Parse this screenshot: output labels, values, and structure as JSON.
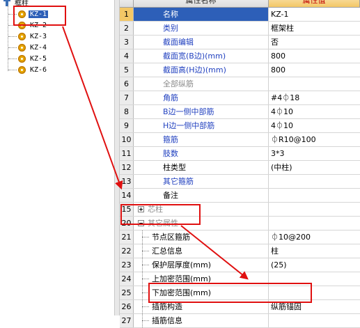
{
  "tree": {
    "root_label": "框柱",
    "items": [
      {
        "label": "KZ-1",
        "selected": true
      },
      {
        "label": "KZ-2"
      },
      {
        "label": "KZ-3"
      },
      {
        "label": "KZ-4"
      },
      {
        "label": "KZ-5"
      },
      {
        "label": "KZ-6"
      }
    ]
  },
  "grid": {
    "header_name": "属性名称",
    "header_value": "属性值",
    "rows": [
      {
        "num": "1",
        "name": "名称",
        "value": "KZ-1"
      },
      {
        "num": "2",
        "name": "类别",
        "value": "框架柱"
      },
      {
        "num": "3",
        "name": "截面编辑",
        "value": "否"
      },
      {
        "num": "4",
        "name": "截面宽(B边)(mm)",
        "value": "800"
      },
      {
        "num": "5",
        "name": "截面高(H边)(mm)",
        "value": "800"
      },
      {
        "num": "6",
        "name": "全部纵筋",
        "value": ""
      },
      {
        "num": "7",
        "name": "角筋",
        "value": "#4⏀18"
      },
      {
        "num": "8",
        "name": "B边一侧中部筋",
        "value": "4⏀10"
      },
      {
        "num": "9",
        "name": "H边一侧中部筋",
        "value": "4⏀10"
      },
      {
        "num": "10",
        "name": "箍筋",
        "value": "⏀R10@100"
      },
      {
        "num": "11",
        "name": "肢数",
        "value": "3*3"
      },
      {
        "num": "12",
        "name": "柱类型",
        "value": "(中柱)"
      },
      {
        "num": "13",
        "name": "其它箍筋",
        "value": ""
      },
      {
        "num": "14",
        "name": "备注",
        "value": ""
      },
      {
        "num": "15",
        "name": "芯柱",
        "value": ""
      },
      {
        "num": "20",
        "name": "其它属性",
        "value": ""
      },
      {
        "num": "21",
        "name": "节点区箍筋",
        "value": "⏀10@200"
      },
      {
        "num": "22",
        "name": "汇总信息",
        "value": "柱"
      },
      {
        "num": "23",
        "name": "保护层厚度(mm)",
        "value": "(25)"
      },
      {
        "num": "24",
        "name": "上加密范围(mm)",
        "value": ""
      },
      {
        "num": "25",
        "name": "下加密范围(mm)",
        "value": ""
      },
      {
        "num": "26",
        "name": "插筋构造",
        "value": "纵筋锚固"
      },
      {
        "num": "27",
        "name": "插筋信息",
        "value": ""
      }
    ]
  },
  "colors": {
    "annotation": "#e01010",
    "selection": "#2d5fb8",
    "header_value_bg": "#f3c766",
    "property_blue": "#1f3fbf"
  }
}
